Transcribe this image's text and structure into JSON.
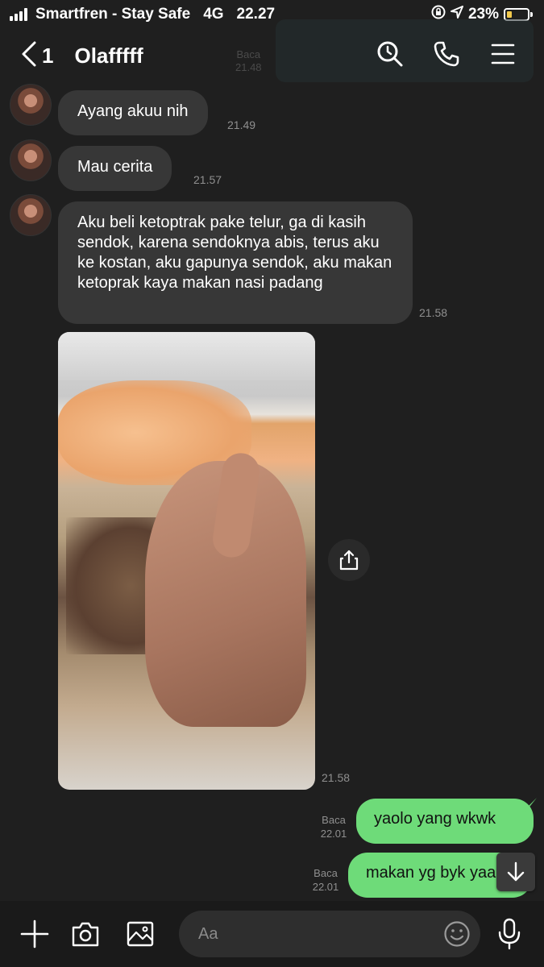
{
  "status_bar": {
    "carrier": "Smartfren - Stay Safe",
    "network": "4G",
    "time": "22.27",
    "battery_percent": "23%",
    "battery_level": 0.23
  },
  "header": {
    "back_count": "1",
    "title": "Olafffff",
    "ghost_read_label": "Baca",
    "ghost_read_time": "21.48"
  },
  "messages": [
    {
      "direction": "in",
      "text": "Ayang akuu nih",
      "time": "21.49"
    },
    {
      "direction": "in",
      "text": "Mau cerita",
      "time": "21.57"
    },
    {
      "direction": "in",
      "text": "Aku beli ketoptrak pake telur, ga di kasih sendok, karena sendoknya abis, terus aku ke kostan, aku gapunya sendok, aku makan ketoprak kaya makan nasi padang",
      "time": "21.58"
    },
    {
      "direction": "in",
      "type": "photo",
      "time": "21.58"
    },
    {
      "direction": "out",
      "text": "yaolo yang wkwk",
      "read_label": "Baca",
      "time": "22.01"
    },
    {
      "direction": "out",
      "text": "makan yg byk yaa",
      "read_label": "Baca",
      "time": "22.01"
    }
  ],
  "input": {
    "placeholder": "Aa"
  },
  "colors": {
    "background": "#1f1f1f",
    "incoming_bubble": "#373737",
    "outgoing_bubble": "#6edb79",
    "battery_fill": "#f2c94c"
  },
  "icons": [
    "back-chevron-icon",
    "search-icon",
    "phone-icon",
    "menu-icon",
    "share-icon",
    "arrow-down-icon",
    "plus-icon",
    "camera-icon",
    "image-icon",
    "emoji-icon",
    "microphone-icon"
  ]
}
